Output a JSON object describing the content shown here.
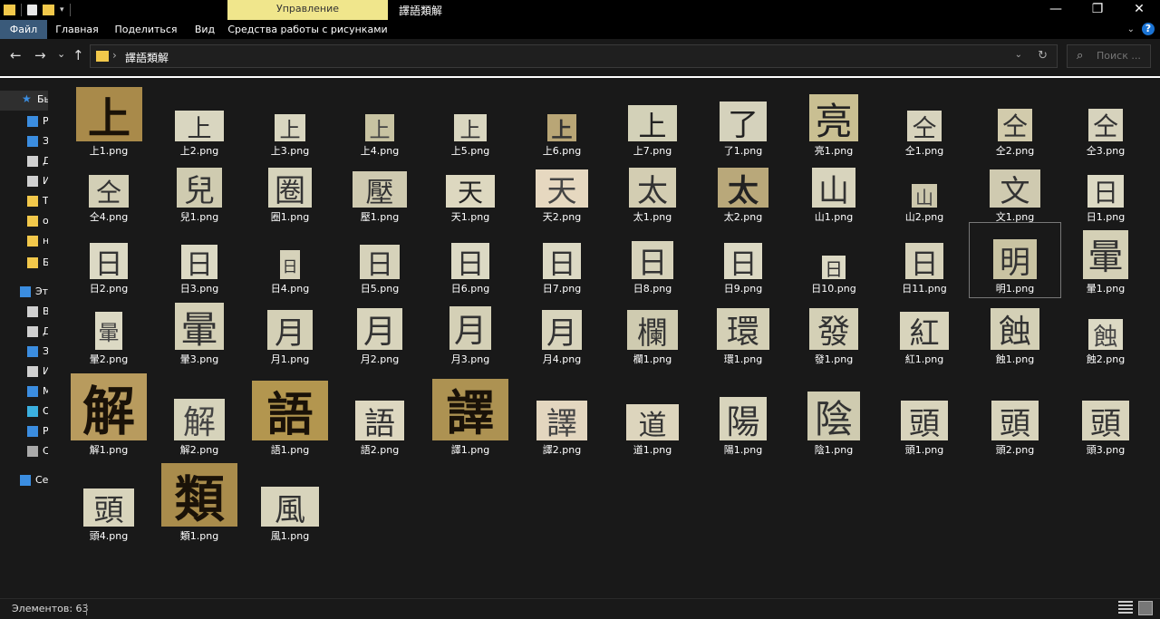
{
  "titlebar": {
    "window_title": "譯語類解",
    "manage_tab": "Управление",
    "controls": [
      "—",
      "❐",
      "✕"
    ]
  },
  "ribbon": {
    "tabs": [
      {
        "label": "Файл",
        "active": true
      },
      {
        "label": "Главная",
        "active": false
      },
      {
        "label": "Поделиться",
        "active": false
      },
      {
        "label": "Вид",
        "active": false
      },
      {
        "label": "Средства работы с рисунками",
        "active": false
      }
    ],
    "help": "?"
  },
  "nav": {
    "back": "←",
    "forward": "→",
    "recent": "⌄",
    "up": "↑"
  },
  "address": {
    "path": "譯語類解",
    "separator": "›",
    "refresh": "↻",
    "dropdown": "⌄"
  },
  "search": {
    "placeholder": "Поиск ..."
  },
  "sidebar": {
    "items": [
      {
        "label": "Бы",
        "icon": "star-icon",
        "color": "#3b8de0"
      },
      {
        "label": "Р",
        "icon": "desktop-icon",
        "color": "#3b8de0"
      },
      {
        "label": "З",
        "icon": "download-icon",
        "color": "#3b8de0"
      },
      {
        "label": "Д",
        "icon": "document-icon",
        "color": "#d0d0d0"
      },
      {
        "label": "И",
        "icon": "pictures-icon",
        "color": "#d0d0d0"
      },
      {
        "label": "Т",
        "icon": "folder-icon",
        "color": "#f2c84b"
      },
      {
        "label": "о",
        "icon": "folder-icon",
        "color": "#f2c84b"
      },
      {
        "label": "н",
        "icon": "folder-icon",
        "color": "#f2c84b"
      },
      {
        "label": "Б",
        "icon": "folder-icon",
        "color": "#f2c84b"
      },
      {
        "label": "Эт",
        "icon": "computer-icon",
        "color": "#3b8de0"
      },
      {
        "label": "В",
        "icon": "video-icon",
        "color": "#d0d0d0"
      },
      {
        "label": "Д",
        "icon": "document-icon",
        "color": "#d0d0d0"
      },
      {
        "label": "З",
        "icon": "download-icon",
        "color": "#3b8de0"
      },
      {
        "label": "И",
        "icon": "pictures-icon",
        "color": "#d0d0d0"
      },
      {
        "label": "М",
        "icon": "music-icon",
        "color": "#3b8de0"
      },
      {
        "label": "О",
        "icon": "3d-objects-icon",
        "color": "#3bb0e0"
      },
      {
        "label": "Р",
        "icon": "desktop-icon",
        "color": "#3b8de0"
      },
      {
        "label": "С",
        "icon": "drive-icon",
        "color": "#aaaaaa"
      },
      {
        "label": "Се",
        "icon": "network-icon",
        "color": "#3b8de0"
      }
    ]
  },
  "files": [
    {
      "name": "上1.png",
      "glyph": "上",
      "bg": "#a98a4a",
      "fg": "#1a1208"
    },
    {
      "name": "上2.png",
      "glyph": "上",
      "bg": "#d9d6c0",
      "fg": "#333"
    },
    {
      "name": "上3.png",
      "glyph": "上",
      "bg": "#d9d6c0",
      "fg": "#333"
    },
    {
      "name": "上4.png",
      "glyph": "上",
      "bg": "#c8c3a2",
      "fg": "#444"
    },
    {
      "name": "上5.png",
      "glyph": "上",
      "bg": "#d9d6c0",
      "fg": "#333"
    },
    {
      "name": "上6.png",
      "glyph": "上",
      "bg": "#b9a676",
      "fg": "#333"
    },
    {
      "name": "上7.png",
      "glyph": "上",
      "bg": "#d3d1b8",
      "fg": "#222"
    },
    {
      "name": "了1.png",
      "glyph": "了",
      "bg": "#d5d2bc",
      "fg": "#222"
    },
    {
      "name": "亮1.png",
      "glyph": "亮",
      "bg": "#c9bf92",
      "fg": "#222"
    },
    {
      "name": "仝1.png",
      "glyph": "仝",
      "bg": "#d7d3bd",
      "fg": "#333"
    },
    {
      "name": "仝2.png",
      "glyph": "仝",
      "bg": "#d2cbac",
      "fg": "#333"
    },
    {
      "name": "仝3.png",
      "glyph": "仝",
      "bg": "#d7d3bd",
      "fg": "#333"
    },
    {
      "name": "仝4.png",
      "glyph": "仝",
      "bg": "#d3cfb6",
      "fg": "#333"
    },
    {
      "name": "兒1.png",
      "glyph": "兒",
      "bg": "#cfcbb0",
      "fg": "#333"
    },
    {
      "name": "圈1.png",
      "glyph": "圈",
      "bg": "#d6d3bb",
      "fg": "#333"
    },
    {
      "name": "壓1.png",
      "glyph": "壓",
      "bg": "#cfcab0",
      "fg": "#333"
    },
    {
      "name": "天1.png",
      "glyph": "天",
      "bg": "#ddd8c0",
      "fg": "#222"
    },
    {
      "name": "天2.png",
      "glyph": "天",
      "bg": "#e6d8c0",
      "fg": "#444"
    },
    {
      "name": "太1.png",
      "glyph": "太",
      "bg": "#d3cdb2",
      "fg": "#333"
    },
    {
      "name": "太2.png",
      "glyph": "太",
      "bg": "#b9a87a",
      "fg": "#222"
    },
    {
      "name": "山1.png",
      "glyph": "山",
      "bg": "#d8d4bd",
      "fg": "#333"
    },
    {
      "name": "山2.png",
      "glyph": "山",
      "bg": "#ccc7ac",
      "fg": "#444"
    },
    {
      "name": "文1.png",
      "glyph": "文",
      "bg": "#cfcab0",
      "fg": "#333"
    },
    {
      "name": "日1.png",
      "glyph": "日",
      "bg": "#dcd9c4",
      "fg": "#333"
    },
    {
      "name": "日2.png",
      "glyph": "日",
      "bg": "#dcd9c4",
      "fg": "#333"
    },
    {
      "name": "日3.png",
      "glyph": "日",
      "bg": "#dcd9c4",
      "fg": "#333"
    },
    {
      "name": "日4.png",
      "glyph": "日",
      "bg": "#d6d2ba",
      "fg": "#333"
    },
    {
      "name": "日5.png",
      "glyph": "日",
      "bg": "#d6d2ba",
      "fg": "#333"
    },
    {
      "name": "日6.png",
      "glyph": "日",
      "bg": "#dcd9c4",
      "fg": "#333"
    },
    {
      "name": "日7.png",
      "glyph": "日",
      "bg": "#dcd9c4",
      "fg": "#333"
    },
    {
      "name": "日8.png",
      "glyph": "日",
      "bg": "#d6d2ba",
      "fg": "#333"
    },
    {
      "name": "日9.png",
      "glyph": "日",
      "bg": "#dcd9c4",
      "fg": "#333"
    },
    {
      "name": "日10.png",
      "glyph": "日",
      "bg": "#dcd9c4",
      "fg": "#333"
    },
    {
      "name": "日11.png",
      "glyph": "日",
      "bg": "#d6d2ba",
      "fg": "#333"
    },
    {
      "name": "明1.png",
      "glyph": "明",
      "bg": "#c9c3a2",
      "fg": "#333"
    },
    {
      "name": "暈1.png",
      "glyph": "暈",
      "bg": "#d4d0b6",
      "fg": "#333"
    },
    {
      "name": "暈2.png",
      "glyph": "暈",
      "bg": "#dcd9c4",
      "fg": "#444"
    },
    {
      "name": "暈3.png",
      "glyph": "暈",
      "bg": "#d4d0b6",
      "fg": "#333"
    },
    {
      "name": "月1.png",
      "glyph": "月",
      "bg": "#d4d0b6",
      "fg": "#333"
    },
    {
      "name": "月2.png",
      "glyph": "月",
      "bg": "#d8d4bc",
      "fg": "#333"
    },
    {
      "name": "月3.png",
      "glyph": "月",
      "bg": "#d4d0b6",
      "fg": "#333"
    },
    {
      "name": "月4.png",
      "glyph": "月",
      "bg": "#d8d4bc",
      "fg": "#333"
    },
    {
      "name": "欄1.png",
      "glyph": "欄",
      "bg": "#cfcbb0",
      "fg": "#333"
    },
    {
      "name": "環1.png",
      "glyph": "環",
      "bg": "#d4d0b6",
      "fg": "#333"
    },
    {
      "name": "發1.png",
      "glyph": "發",
      "bg": "#d4d0b6",
      "fg": "#333"
    },
    {
      "name": "紅1.png",
      "glyph": "紅",
      "bg": "#d8d4bc",
      "fg": "#333"
    },
    {
      "name": "蝕1.png",
      "glyph": "蝕",
      "bg": "#d4d0b6",
      "fg": "#333"
    },
    {
      "name": "蝕2.png",
      "glyph": "蝕",
      "bg": "#dcd9c4",
      "fg": "#444"
    },
    {
      "name": "解1.png",
      "glyph": "解",
      "bg": "#b89b5e",
      "fg": "#1a1208"
    },
    {
      "name": "解2.png",
      "glyph": "解",
      "bg": "#d6d3bb",
      "fg": "#444"
    },
    {
      "name": "語1.png",
      "glyph": "語",
      "bg": "#b3964f",
      "fg": "#1a1208"
    },
    {
      "name": "語2.png",
      "glyph": "語",
      "bg": "#ddd7c0",
      "fg": "#333"
    },
    {
      "name": "譯1.png",
      "glyph": "譯",
      "bg": "#ad9252",
      "fg": "#1a1208"
    },
    {
      "name": "譯2.png",
      "glyph": "譯",
      "bg": "#e3d6bf",
      "fg": "#444"
    },
    {
      "name": "道1.png",
      "glyph": "道",
      "bg": "#ddd5bd",
      "fg": "#333"
    },
    {
      "name": "陽1.png",
      "glyph": "陽",
      "bg": "#d8d4bc",
      "fg": "#333"
    },
    {
      "name": "陰1.png",
      "glyph": "陰",
      "bg": "#cfcbb0",
      "fg": "#333"
    },
    {
      "name": "頭1.png",
      "glyph": "頭",
      "bg": "#d8d4bc",
      "fg": "#333"
    },
    {
      "name": "頭2.png",
      "glyph": "頭",
      "bg": "#d8d4bc",
      "fg": "#333"
    },
    {
      "name": "頭3.png",
      "glyph": "頭",
      "bg": "#d8d4bc",
      "fg": "#333"
    },
    {
      "name": "頭4.png",
      "glyph": "頭",
      "bg": "#d8d4bc",
      "fg": "#333"
    },
    {
      "name": "類1.png",
      "glyph": "類",
      "bg": "#a98c4c",
      "fg": "#1a1208"
    },
    {
      "name": "風1.png",
      "glyph": "風",
      "bg": "#d8d4bc",
      "fg": "#333"
    }
  ],
  "selected_file": "明1.png",
  "status": {
    "count": "Элементов: 63"
  }
}
